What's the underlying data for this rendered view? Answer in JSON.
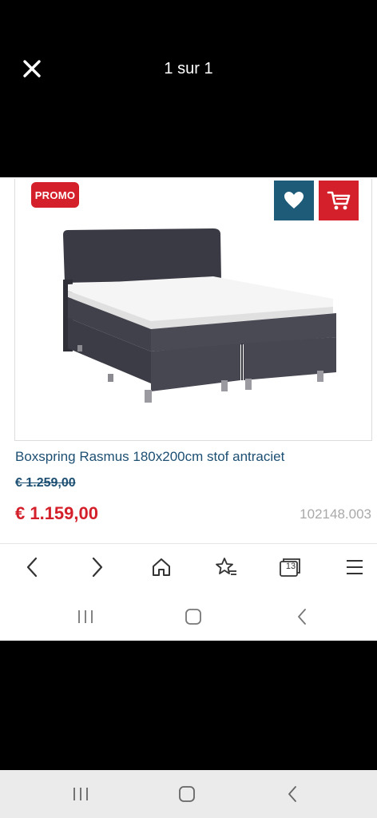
{
  "viewer": {
    "page_counter": "1 sur 1",
    "close_icon": "close-icon"
  },
  "product": {
    "badge": "PROMO",
    "title": "Boxspring Rasmus 180x200cm stof antraciet",
    "old_price": "€ 1.259,00",
    "new_price": "€ 1.159,00",
    "sku": "102148.003",
    "image_icon": "boxspring-bed-image"
  },
  "actions": {
    "wishlist_icon": "heart-icon",
    "cart_icon": "cart-icon"
  },
  "browser_nav": {
    "tab_count": "13",
    "icons": [
      "back-icon",
      "forward-icon",
      "home-icon",
      "bookmark-star-icon",
      "tabs-icon",
      "menu-icon"
    ]
  },
  "colors": {
    "accent_red": "#d3202a",
    "accent_blue": "#1d5b78",
    "title_blue": "#1d4f73",
    "sku_gray": "#a9a9a9"
  }
}
